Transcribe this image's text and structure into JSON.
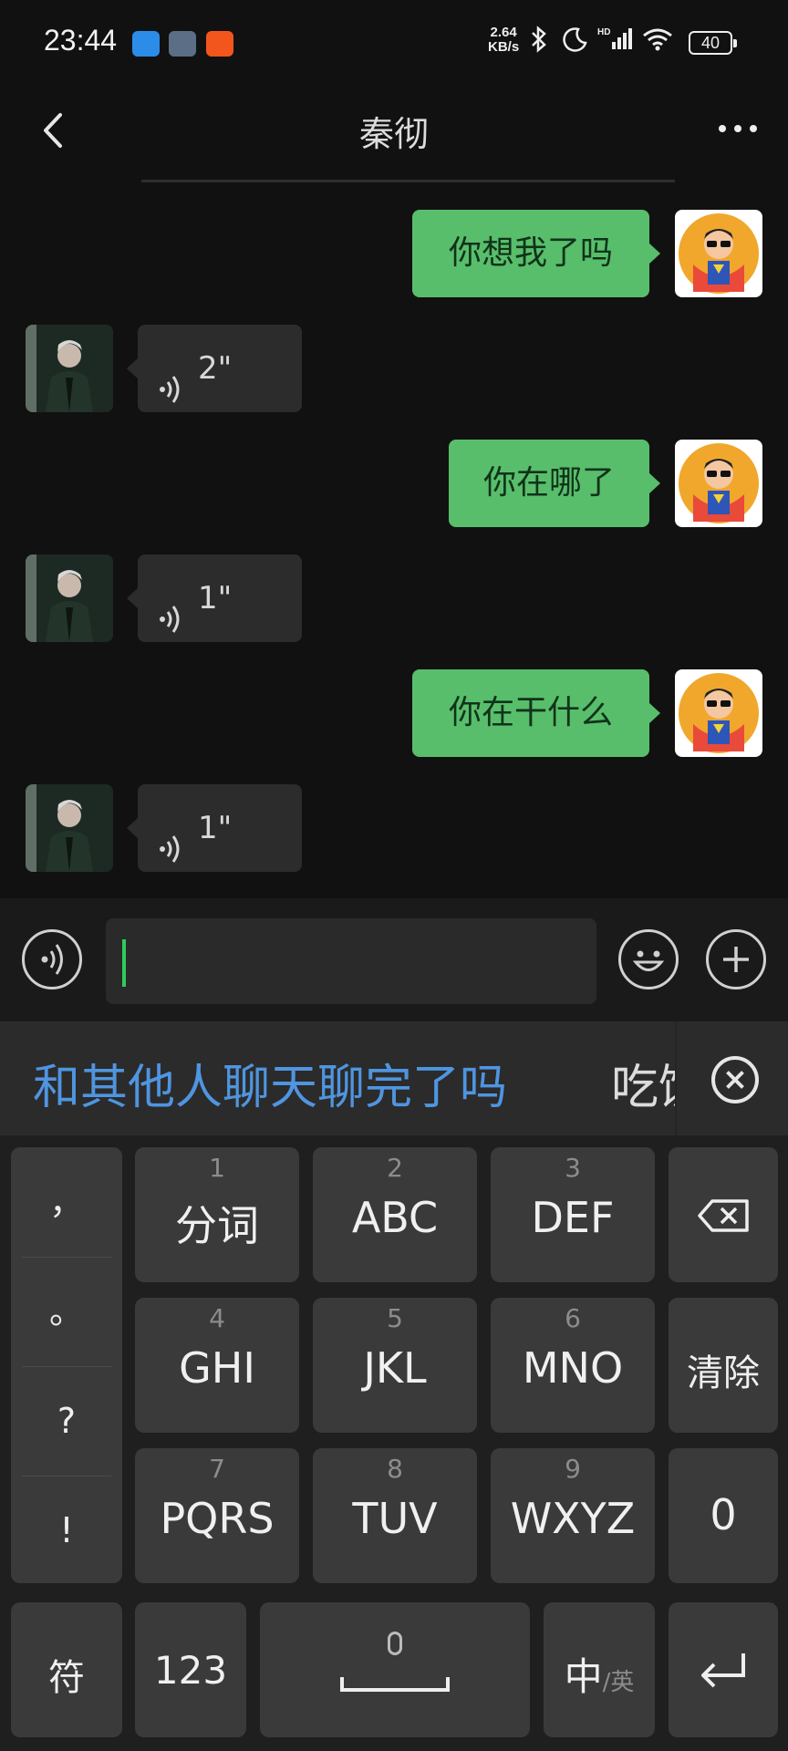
{
  "status_bar": {
    "time": "23:44",
    "net_speed_value": "2.64",
    "net_speed_unit": "KB/s",
    "battery": "40",
    "icons": [
      "cloud-app-icon",
      "tools-app-icon",
      "video-app-icon",
      "bluetooth-icon",
      "do-not-disturb-icon",
      "hd-signal-icon",
      "wifi-icon",
      "battery-icon"
    ]
  },
  "header": {
    "title": "秦彻",
    "back_icon": "chevron-left-icon",
    "more_icon": "more-dots-icon"
  },
  "messages": [
    {
      "side": "sent",
      "type": "text",
      "text": "你想我了吗"
    },
    {
      "side": "received",
      "type": "voice",
      "duration": "2\""
    },
    {
      "side": "sent",
      "type": "text",
      "text": "你在哪了"
    },
    {
      "side": "received",
      "type": "voice",
      "duration": "1\""
    },
    {
      "side": "sent",
      "type": "text",
      "text": "你在干什么"
    },
    {
      "side": "received",
      "type": "voice",
      "duration": "1\""
    }
  ],
  "input_bar": {
    "value": "",
    "voice_button_icon": "voice-input-icon",
    "emoji_button_icon": "emoji-icon",
    "add_button_icon": "plus-icon"
  },
  "suggestions": {
    "items": [
      "和其他人聊天聊完了吗",
      "吃饭"
    ],
    "close_icon": "close-circle-icon"
  },
  "keyboard": {
    "punctuation": [
      "，",
      "。",
      "?",
      "!"
    ],
    "rows": [
      [
        {
          "num": "1",
          "label": "分词"
        },
        {
          "num": "2",
          "label": "ABC"
        },
        {
          "num": "3",
          "label": "DEF"
        }
      ],
      [
        {
          "num": "4",
          "label": "GHI"
        },
        {
          "num": "5",
          "label": "JKL"
        },
        {
          "num": "6",
          "label": "MNO"
        }
      ],
      [
        {
          "num": "7",
          "label": "PQRS"
        },
        {
          "num": "8",
          "label": "TUV"
        },
        {
          "num": "9",
          "label": "WXYZ"
        }
      ]
    ],
    "backspace_icon": "backspace-icon",
    "clear_label": "清除",
    "zero_label": "0",
    "symbol_label": "符",
    "numbers_label": "123",
    "lang_main": "中",
    "lang_alt": "/英",
    "enter_icon": "enter-icon",
    "space_mic_icon": "mic-icon"
  },
  "colors": {
    "background": "#111111",
    "sent_bubble": "#58be6b",
    "received_bubble": "#2c2c2c",
    "suggestion_highlight": "#4f95e0",
    "caret": "#2fcb5c"
  }
}
